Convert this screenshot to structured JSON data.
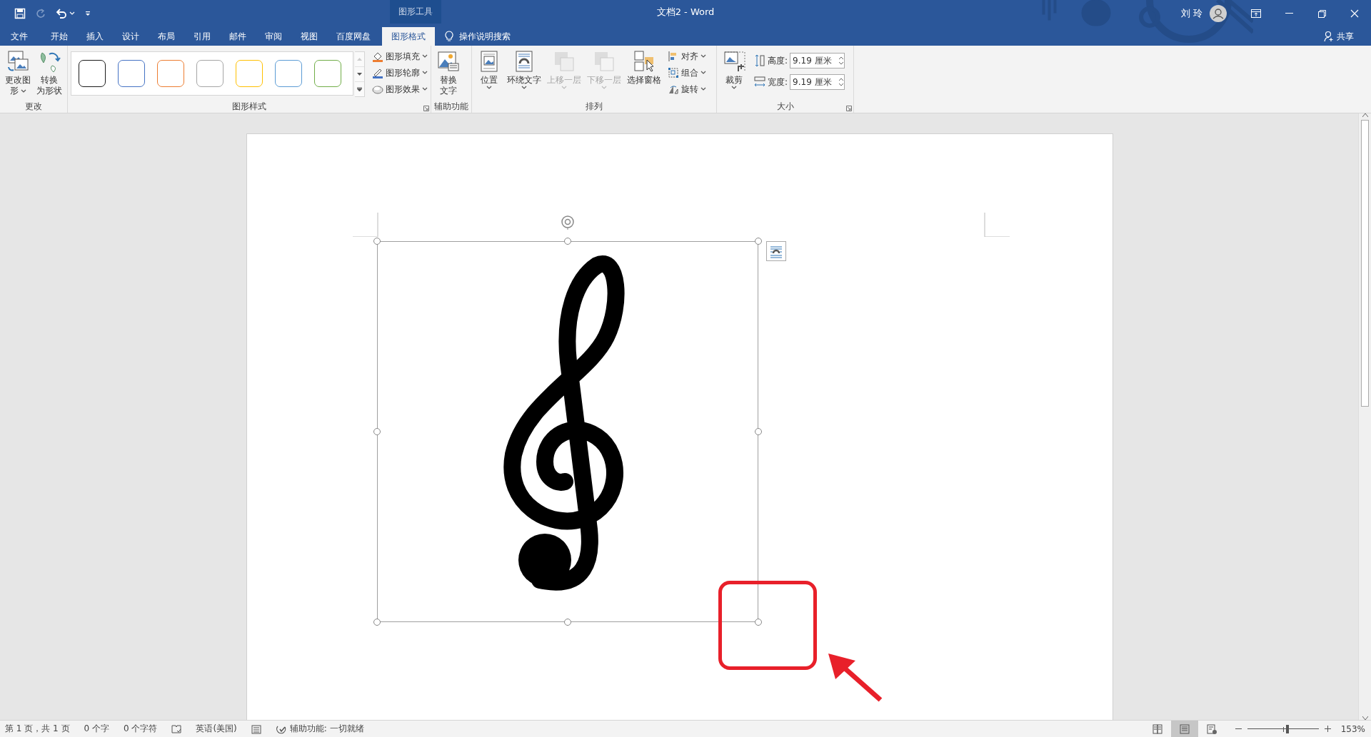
{
  "title_bar": {
    "contextual_tab_group": "图形工具",
    "document_title": "文档2 - Word",
    "user_name": "刘 玲"
  },
  "tabs": [
    {
      "label": "文件",
      "selected": false
    },
    {
      "label": "开始",
      "selected": false
    },
    {
      "label": "插入",
      "selected": false
    },
    {
      "label": "设计",
      "selected": false
    },
    {
      "label": "布局",
      "selected": false
    },
    {
      "label": "引用",
      "selected": false
    },
    {
      "label": "邮件",
      "selected": false
    },
    {
      "label": "审阅",
      "selected": false
    },
    {
      "label": "视图",
      "selected": false
    },
    {
      "label": "百度网盘",
      "selected": false
    },
    {
      "label": "图形格式",
      "selected": true
    }
  ],
  "tell_me": {
    "placeholder": "操作说明搜索"
  },
  "share": "共享",
  "ribbon": {
    "change_group": {
      "title": "更改",
      "buttons": [
        {
          "lines": [
            "更改图",
            "形"
          ],
          "dropdown": true
        },
        {
          "lines": [
            "转换",
            "为形状"
          ],
          "dropdown": false
        }
      ]
    },
    "styles_group": {
      "title": "图形样式",
      "swatches": [
        {
          "color": "#1a1a1a"
        },
        {
          "color": "#4472c4"
        },
        {
          "color": "#ed7d31"
        },
        {
          "color": "#a5a5a5"
        },
        {
          "color": "#ffc000"
        },
        {
          "color": "#5b9bd5"
        },
        {
          "color": "#70ad47"
        }
      ],
      "commands": [
        {
          "label": "图形填充"
        },
        {
          "label": "图形轮廓"
        },
        {
          "label": "图形效果"
        }
      ]
    },
    "accessibility_group": {
      "title": "辅助功能",
      "buttons": [
        {
          "lines": [
            "替换",
            "文字"
          ],
          "dropdown": false
        }
      ]
    },
    "arrange_group": {
      "title": "排列",
      "buttons": [
        {
          "lines": [
            "位置"
          ],
          "dropdown": true,
          "disabled": false
        },
        {
          "lines": [
            "环绕文字"
          ],
          "dropdown": true,
          "disabled": false
        },
        {
          "lines": [
            "上移一层"
          ],
          "dropdown": true,
          "disabled": true
        },
        {
          "lines": [
            "下移一层"
          ],
          "dropdown": true,
          "disabled": true
        },
        {
          "lines": [
            "选择窗格"
          ],
          "dropdown": false,
          "disabled": false
        }
      ],
      "commands": [
        {
          "label": "对齐"
        },
        {
          "label": "组合"
        },
        {
          "label": "旋转"
        }
      ]
    },
    "size_group": {
      "title": "大小",
      "crop": {
        "lines": [
          "裁剪"
        ],
        "dropdown": true
      },
      "fields": [
        {
          "label": "高度:",
          "value": "9.19 厘米"
        },
        {
          "label": "宽度:",
          "value": "9.19 厘米"
        }
      ]
    }
  },
  "status_bar": {
    "items": [
      "第 1 页，共 1 页",
      "0 个字",
      "0 个字符"
    ],
    "language": "英语(美国)",
    "accessibility": "辅助功能: 一切就绪",
    "view_buttons": [
      {
        "selected": false
      },
      {
        "selected": true
      },
      {
        "selected": false
      }
    ],
    "zoom": {
      "level": 0.56,
      "reading": "153%"
    }
  }
}
